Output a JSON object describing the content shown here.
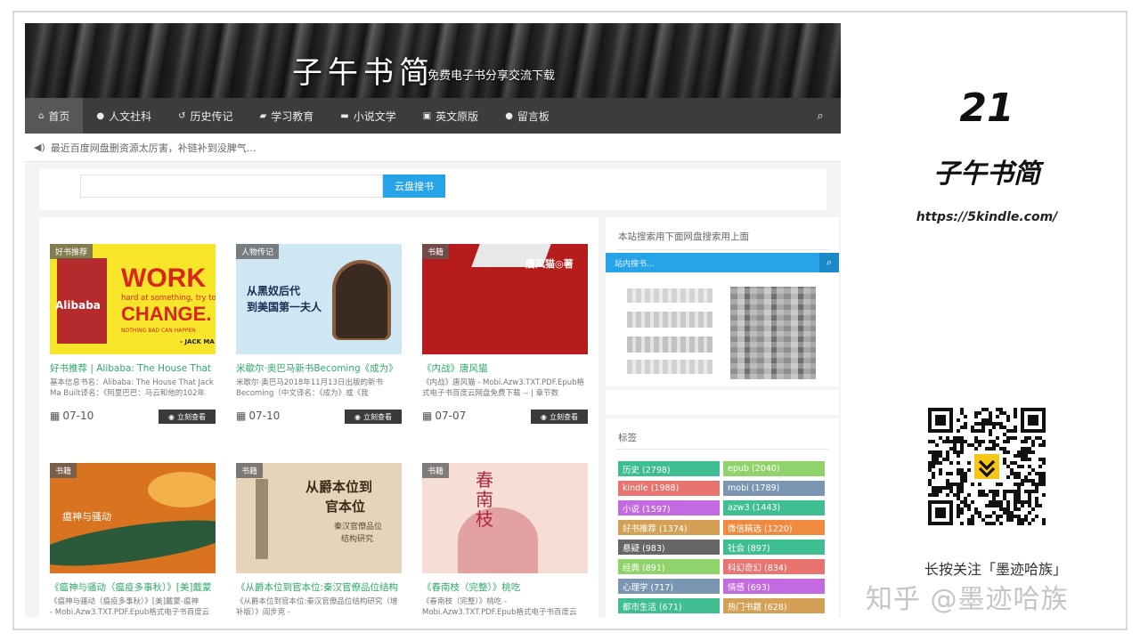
{
  "site": {
    "title": "子午书简",
    "subtitle": "免费电子书分享交流下载",
    "nav": [
      "首页",
      "人文社科",
      "历史传记",
      "学习教育",
      "小说文学",
      "英文原版",
      "留言板"
    ],
    "notice": "最近百度网盘删资源太厉害，补链补到没脾气...",
    "search_button": "云盘搜书"
  },
  "posts": [
    {
      "category": "好书推荐",
      "title": "好书推荐 | Alibaba: The House That",
      "excerpt": "基本信息书名：Alibaba: The House That Jack Ma Built译名：《阿里巴巴：马云和他的102年",
      "date": "07-10",
      "more": "立刻查看",
      "cover": {
        "line1": "WORK",
        "line2": "hard at something, try to",
        "line3": "CHANGE.",
        "line4": "NOTHING BAD CAN HAPPEN",
        "author": "- JACK MA",
        "brand": "Alibaba"
      }
    },
    {
      "category": "人物传记",
      "title": "米歇尔·奥巴马新书Becoming《成为》",
      "excerpt": "米歇尔·奥巴马2018年11月13日出版的新书Becoming（中文译名：《成为》或《我",
      "date": "07-10",
      "more": "立刻查看",
      "cover": {
        "line1": "从黑奴后代",
        "line2": "到美国第一夫人"
      }
    },
    {
      "category": "书籍",
      "title": "《内战》唐风猫",
      "excerpt": "《内战》唐风猫 - Mobi.Azw3.TXT.PDF.Epub格式电子书百度云网盘免费下载 -- | 章节数",
      "date": "07-07",
      "more": "立刻查看",
      "cover": {
        "author": "唐风猫◎著"
      }
    },
    {
      "category": "书籍",
      "title": "《瘟神与骚动（瘟疫多事秋）》[美]戴蒙",
      "excerpt": "《瘟神与骚动（瘟疫多事秋）》[美]戴蒙-瘟神",
      "excerpt2": "- Mobi.Azw3.TXT.PDF.Epub格式电子书百度云",
      "date": "",
      "more": "",
      "cover": {
        "line1": "瘟神与骚动"
      }
    },
    {
      "category": "书籍",
      "title": "《从爵本位到官本位:秦汉官僚品位结构",
      "excerpt": "《从爵本位到官本位:秦汉官僚品位结构研究（增补版）》阎步克 -",
      "date": "",
      "more": "",
      "cover": {
        "line1": "从爵本位到",
        "line2": "官本位",
        "line3": "秦汉官僚品位",
        "line4": "结构研究"
      }
    },
    {
      "category": "书籍",
      "title": "《春南枝（完整）》桃吃",
      "excerpt": "《春南枝（完整）》桃吃 -",
      "excerpt2": "Mobi.Azw3.TXT.PDF.Epub格式电子书百度云",
      "date": "",
      "more": "",
      "cover": {
        "line1": "春南枝"
      }
    }
  ],
  "sidebar": {
    "search_heading": "本站搜索用下面网盘搜索用上面",
    "search_placeholder": "站内搜书...",
    "tags_heading": "标签",
    "tags": [
      {
        "label": "历史 (2798)",
        "color": "#3fbf91"
      },
      {
        "label": "epub (2040)",
        "color": "#8fd36a"
      },
      {
        "label": "kindle (1988)",
        "color": "#e8736f"
      },
      {
        "label": "mobi (1789)",
        "color": "#7b96b2"
      },
      {
        "label": "小说 (1597)",
        "color": "#c46ae0"
      },
      {
        "label": "azw3 (1443)",
        "color": "#3fbf91"
      },
      {
        "label": "好书推荐 (1374)",
        "color": "#d4a055"
      },
      {
        "label": "微信精选 (1220)",
        "color": "#f08a3e"
      },
      {
        "label": "悬疑 (983)",
        "color": "#666666"
      },
      {
        "label": "社会 (897)",
        "color": "#3fbf91"
      },
      {
        "label": "经典 (891)",
        "color": "#8fd36a"
      },
      {
        "label": "科幻奇幻 (834)",
        "color": "#e8736f"
      },
      {
        "label": "心理学 (717)",
        "color": "#7b96b2"
      },
      {
        "label": "情感 (693)",
        "color": "#c46ae0"
      },
      {
        "label": "都市生活 (671)",
        "color": "#3fbf91"
      },
      {
        "label": "热门书籍 (628)",
        "color": "#d4a055"
      }
    ]
  },
  "panel": {
    "number": "21",
    "title": "子午书简",
    "url": "https://5kindle.com/",
    "follow": "长按关注「墨迹哈族」",
    "watermark": "知乎 @墨迹哈族"
  }
}
